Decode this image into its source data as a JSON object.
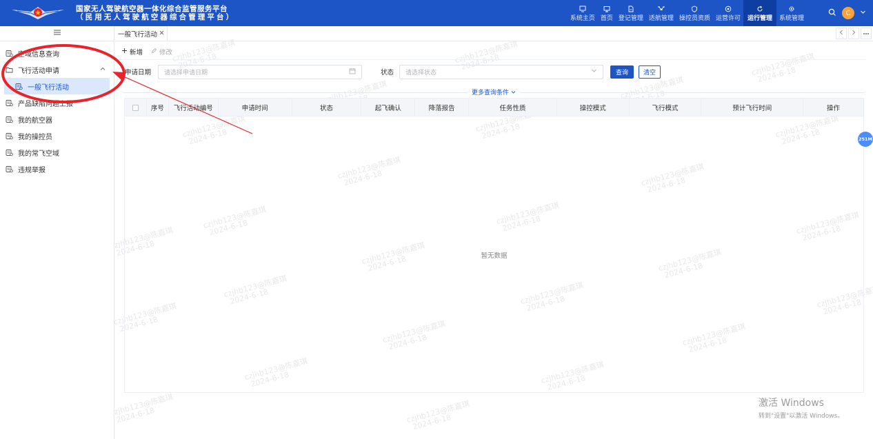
{
  "header": {
    "title_line1": "国家无人驾驶航空器一体化综合监管服务平台",
    "title_line2": "（民用无人驾驶航空器综合管理平台）",
    "nav": [
      {
        "label": "系统主页",
        "icon": "monitor-icon",
        "active": false
      },
      {
        "label": "首页",
        "icon": "desktop-icon",
        "active": false
      },
      {
        "label": "登记管理",
        "icon": "document-icon",
        "active": false
      },
      {
        "label": "适航管理",
        "icon": "drone-icon",
        "active": false
      },
      {
        "label": "操控员资质",
        "icon": "shield-icon",
        "active": false
      },
      {
        "label": "运营许可",
        "icon": "badge-icon",
        "active": false
      },
      {
        "label": "运行管理",
        "icon": "refresh-icon",
        "active": true
      },
      {
        "label": "系统管理",
        "icon": "gear-icon",
        "active": false
      }
    ],
    "avatar_letter": "C"
  },
  "sidebar": {
    "items": [
      {
        "label": "空域信息查询"
      },
      {
        "label": "飞行活动申请"
      },
      {
        "label": "一般飞行活动"
      },
      {
        "label": "产品缺陷问题上报"
      },
      {
        "label": "我的航空器"
      },
      {
        "label": "我的操控员"
      },
      {
        "label": "我的常飞空域"
      },
      {
        "label": "违规举报"
      }
    ]
  },
  "tabs": [
    {
      "label": "一般飞行活动"
    }
  ],
  "toolbar": {
    "add_label": "新增",
    "edit_label": "修改"
  },
  "filter": {
    "date_label": "申请日期",
    "date_placeholder": "请选择申请日期",
    "status_label": "状态",
    "status_placeholder": "请选择状态",
    "search_label": "查询",
    "clear_label": "清空",
    "more_label": "更多查询条件"
  },
  "table": {
    "columns": [
      "序号",
      "飞行活动编号",
      "申请时间",
      "状态",
      "起飞确认",
      "降落报告",
      "任务性质",
      "操控模式",
      "飞行模式",
      "预计飞行时间",
      "操作"
    ],
    "empty_text": "暂无数据"
  },
  "badge": "251M",
  "watermark": {
    "line1": "czjhb123@陈嘉琪",
    "line2": "2024-6-18"
  },
  "windows_notice": {
    "line1": "激活 Windows",
    "line2": "转到\"设置\"以激活 Windows。"
  },
  "colors": {
    "header_bg": "#1d55c6",
    "active_nav": "#0f3ea3",
    "annotation": "#e8232a"
  }
}
